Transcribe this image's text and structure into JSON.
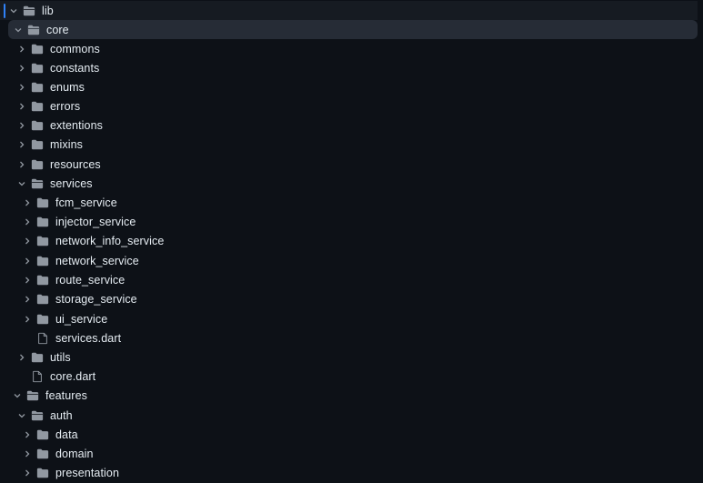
{
  "file_tree": {
    "items": [
      {
        "label": "lib",
        "type": "folder",
        "expanded": true
      },
      {
        "label": "core",
        "type": "folder",
        "expanded": true
      },
      {
        "label": "commons",
        "type": "folder",
        "expanded": false
      },
      {
        "label": "constants",
        "type": "folder",
        "expanded": false
      },
      {
        "label": "enums",
        "type": "folder",
        "expanded": false
      },
      {
        "label": "errors",
        "type": "folder",
        "expanded": false
      },
      {
        "label": "extentions",
        "type": "folder",
        "expanded": false
      },
      {
        "label": "mixins",
        "type": "folder",
        "expanded": false
      },
      {
        "label": "resources",
        "type": "folder",
        "expanded": false
      },
      {
        "label": "services",
        "type": "folder",
        "expanded": true
      },
      {
        "label": "fcm_service",
        "type": "folder",
        "expanded": false
      },
      {
        "label": "injector_service",
        "type": "folder",
        "expanded": false
      },
      {
        "label": "network_info_service",
        "type": "folder",
        "expanded": false
      },
      {
        "label": "network_service",
        "type": "folder",
        "expanded": false
      },
      {
        "label": "route_service",
        "type": "folder",
        "expanded": false
      },
      {
        "label": "storage_service",
        "type": "folder",
        "expanded": false
      },
      {
        "label": "ui_service",
        "type": "folder",
        "expanded": false
      },
      {
        "label": "services.dart",
        "type": "file"
      },
      {
        "label": "utils",
        "type": "folder",
        "expanded": false
      },
      {
        "label": "core.dart",
        "type": "file"
      },
      {
        "label": "features",
        "type": "folder",
        "expanded": true
      },
      {
        "label": "auth",
        "type": "folder",
        "expanded": true
      },
      {
        "label": "data",
        "type": "folder",
        "expanded": false
      },
      {
        "label": "domain",
        "type": "folder",
        "expanded": false
      },
      {
        "label": "presentation",
        "type": "folder",
        "expanded": false
      }
    ]
  },
  "colors": {
    "background": "#0d1117",
    "selected_row": "#262c36",
    "hover_row": "#161b22",
    "active_indicator": "#2f81f7",
    "folder_icon": "#9198a1",
    "text": "#e6edf3"
  }
}
